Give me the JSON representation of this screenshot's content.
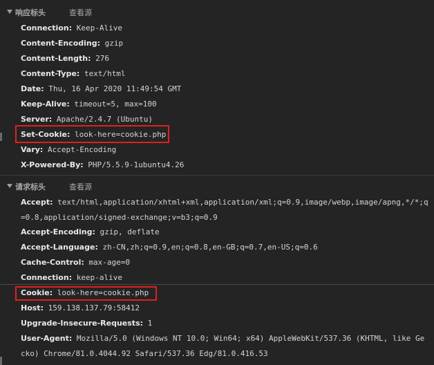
{
  "response_section": {
    "title": "响应标头",
    "view_source": "查看源",
    "headers": [
      {
        "key": "Connection:",
        "value": "Keep-Alive"
      },
      {
        "key": "Content-Encoding:",
        "value": "gzip"
      },
      {
        "key": "Content-Length:",
        "value": "276"
      },
      {
        "key": "Content-Type:",
        "value": "text/html"
      },
      {
        "key": "Date:",
        "value": "Thu, 16 Apr 2020 11:49:54 GMT"
      },
      {
        "key": "Keep-Alive:",
        "value": "timeout=5, max=100"
      },
      {
        "key": "Server:",
        "value": "Apache/2.4.7 (Ubuntu)"
      },
      {
        "key": "Set-Cookie:",
        "value": "look-here=cookie.php"
      },
      {
        "key": "Vary:",
        "value": "Accept-Encoding"
      },
      {
        "key": "X-Powered-By:",
        "value": "PHP/5.5.9-1ubuntu4.26"
      }
    ]
  },
  "request_section": {
    "title": "请求标头",
    "view_source": "查看源",
    "headers": [
      {
        "key": "Accept:",
        "value": "text/html,application/xhtml+xml,application/xml;q=0.9,image/webp,image/apng,*/*;q=0.8,application/signed-exchange;v=b3;q=0.9"
      },
      {
        "key": "Accept-Encoding:",
        "value": "gzip, deflate"
      },
      {
        "key": "Accept-Language:",
        "value": "zh-CN,zh;q=0.9,en;q=0.8,en-GB;q=0.7,en-US;q=0.6"
      },
      {
        "key": "Cache-Control:",
        "value": "max-age=0"
      },
      {
        "key": "Connection:",
        "value": "keep-alive"
      },
      {
        "key": "Cookie:",
        "value": "look-here=cookie.php"
      },
      {
        "key": "Host:",
        "value": "159.138.137.79:58412"
      },
      {
        "key": "Upgrade-Insecure-Requests:",
        "value": "1"
      },
      {
        "key": "User-Agent:",
        "value": "Mozilla/5.0 (Windows NT 10.0; Win64; x64) AppleWebKit/537.36 (KHTML, like Gecko) Chrome/81.0.4044.92 Safari/537.36 Edg/81.0.416.53"
      }
    ]
  },
  "colors": {
    "background": "#242424",
    "highlight_border": "#e02020",
    "key_text": "#e8e8e8",
    "value_text": "#d4d4d4"
  }
}
